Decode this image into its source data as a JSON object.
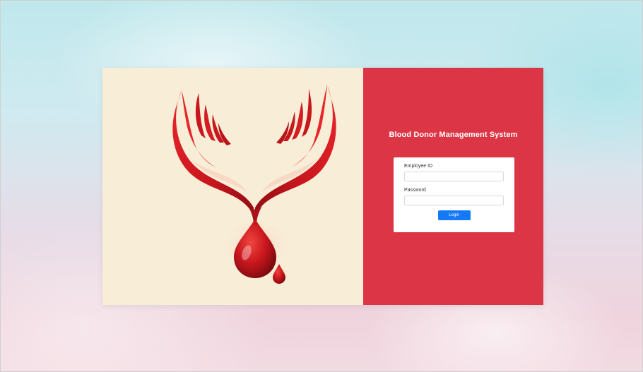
{
  "app": {
    "title": "Blood Donor Management System"
  },
  "logo": {
    "icon": "blood-donation-hands-drop",
    "colors": {
      "primary": "#c8161d",
      "highlight": "#e8252b",
      "dark": "#8e0c12"
    }
  },
  "login_form": {
    "employee_id_label": "Employee ID",
    "employee_id_value": "",
    "employee_id_placeholder": "",
    "password_label": "Password",
    "password_value": "",
    "password_placeholder": "",
    "login_button_label": "Login"
  },
  "colors": {
    "panel_right": "#dc3545",
    "panel_left": "#f8edd6",
    "button": "#1479f5"
  }
}
